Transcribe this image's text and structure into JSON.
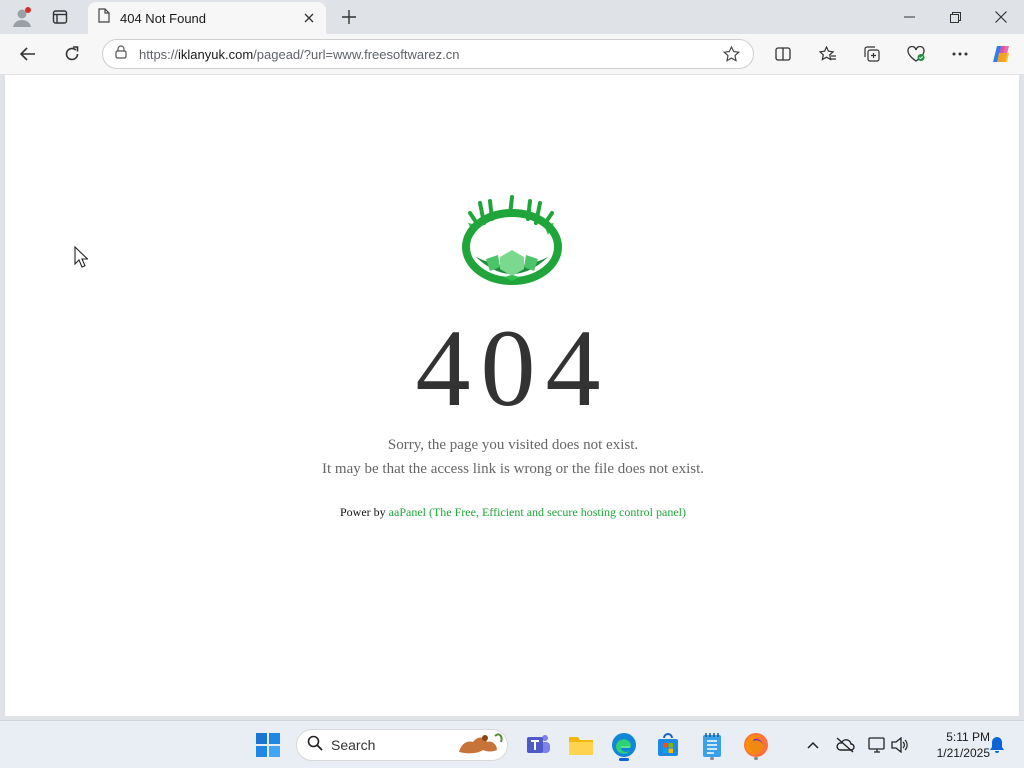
{
  "browser": {
    "tab": {
      "title": "404 Not Found"
    },
    "address": {
      "scheme": "https://",
      "host": "iklanyuk.com",
      "path": "/pagead/?url=www.freesoftwarez.cn"
    }
  },
  "page": {
    "code": "404",
    "message_line1": "Sorry, the page you visited does not exist.",
    "message_line2": "It may be that the access link is wrong or the file does not exist.",
    "power_prefix": "Power by",
    "power_link": "aaPanel (The Free, Efficient and secure hosting control panel)"
  },
  "taskbar": {
    "search_label": "Search",
    "time": "5:11 PM",
    "date": "1/21/2025"
  },
  "colors": {
    "accent_green": "#20a53a",
    "edge_blue": "#0a64d8"
  }
}
